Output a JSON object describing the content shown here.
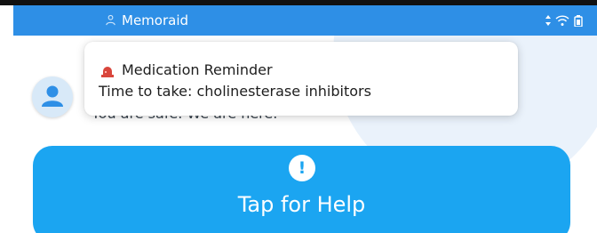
{
  "app_bar": {
    "title": "Memoraid",
    "logo_icon": "person-outline-icon",
    "status_icons": [
      "signal-icon",
      "wifi-icon",
      "battery-icon"
    ],
    "color": "#2e8fe6"
  },
  "background_text": "You are safe. We are here.",
  "notification": {
    "icon": "alarm-light-icon",
    "title": "Medication Reminder",
    "body": "Time to take: cholinesterase inhibitors"
  },
  "help_button": {
    "icon": "exclamation-icon",
    "icon_glyph": "!",
    "label": "Tap for Help",
    "color": "#1ba5f1"
  },
  "avatar": {
    "icon": "user-icon"
  }
}
